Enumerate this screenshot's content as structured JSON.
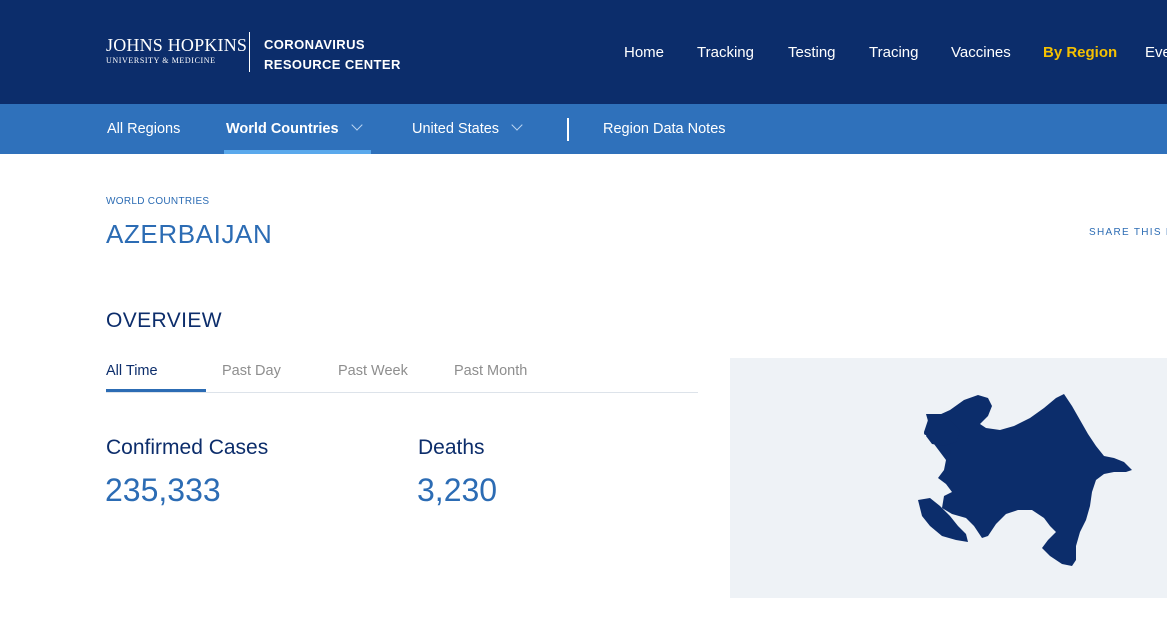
{
  "brand": {
    "university_line1": "JOHNS HOPKINS",
    "university_line2": "UNIVERSITY & MEDICINE",
    "center_line1": "CORONAVIRUS",
    "center_line2": "RESOURCE CENTER"
  },
  "main_nav": {
    "items": [
      {
        "label": "Home"
      },
      {
        "label": "Tracking"
      },
      {
        "label": "Testing"
      },
      {
        "label": "Tracing"
      },
      {
        "label": "Vaccines"
      },
      {
        "label": "By Region",
        "active": true
      },
      {
        "label": "Eve"
      }
    ]
  },
  "sub_nav": {
    "items": [
      {
        "label": "All Regions"
      },
      {
        "label": "World Countries",
        "active": true,
        "icon": "chevron-down-icon"
      },
      {
        "label": "United States",
        "icon": "chevron-down-icon"
      },
      {
        "label": "Region Data Notes"
      }
    ]
  },
  "page": {
    "breadcrumb": "WORLD COUNTRIES",
    "title": "AZERBAIJAN",
    "share_label": "SHARE THIS P"
  },
  "overview": {
    "title": "OVERVIEW",
    "tabs": [
      {
        "label": "All Time",
        "active": true
      },
      {
        "label": "Past Day"
      },
      {
        "label": "Past Week"
      },
      {
        "label": "Past Month"
      }
    ],
    "stats": [
      {
        "label": "Confirmed Cases",
        "value": "235,333"
      },
      {
        "label": "Deaths",
        "value": "3,230"
      }
    ]
  },
  "map": {
    "country_icon": "azerbaijan-map-icon"
  },
  "colors": {
    "header_bg": "#0c2d6b",
    "subnav_bg": "#2f71bb",
    "accent_yellow": "#f5c100",
    "link_blue": "#2c6cb4",
    "map_fill": "#0c2d6b",
    "map_bg": "#eef2f6"
  }
}
